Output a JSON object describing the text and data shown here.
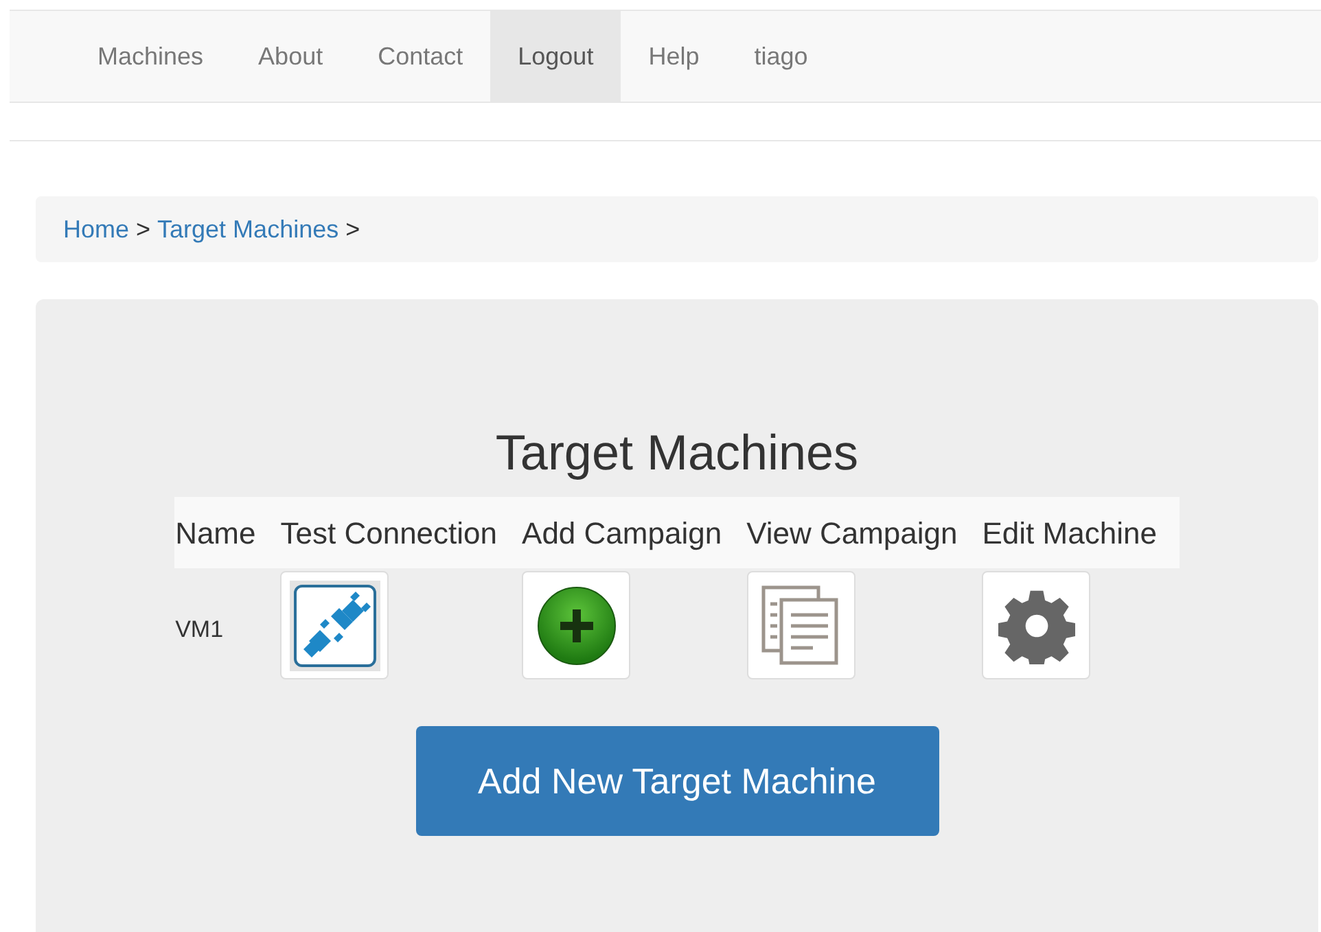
{
  "navbar": {
    "items": [
      {
        "label": "Machines",
        "selected": false
      },
      {
        "label": "About",
        "selected": false
      },
      {
        "label": "Contact",
        "selected": false
      },
      {
        "label": "Logout",
        "selected": true
      },
      {
        "label": "Help",
        "selected": false
      },
      {
        "label": "tiago",
        "selected": false
      }
    ]
  },
  "breadcrumb": [
    {
      "kind": "link",
      "text": "Home"
    },
    {
      "kind": "separator",
      "text": ">"
    },
    {
      "kind": "link",
      "text": "Target Machines"
    },
    {
      "kind": "separator",
      "text": ">"
    }
  ],
  "panel": {
    "title": "Target Machines",
    "table": {
      "columns": [
        "Name",
        "Test Connection",
        "Add Campaign",
        "View Campaign",
        "Edit Machine"
      ],
      "rows": [
        {
          "name": "VM1",
          "actions": [
            {
              "kind": "plug"
            },
            {
              "kind": "add"
            },
            {
              "kind": "documents"
            },
            {
              "kind": "gear"
            }
          ]
        }
      ]
    },
    "button": "Add New Target Machine"
  }
}
